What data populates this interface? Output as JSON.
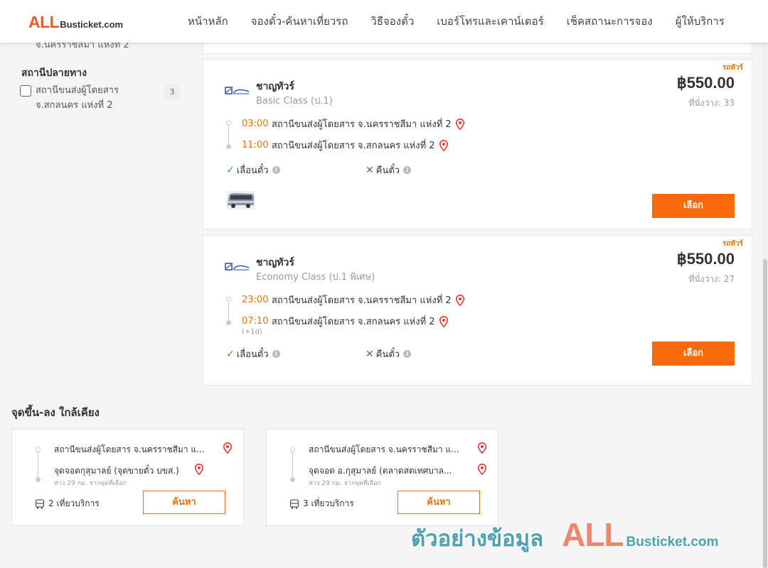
{
  "header": {
    "logo_all": "ALL",
    "logo_rest": "Busticket.com",
    "nav": [
      "หน้าหลัก",
      "จองตั๋ว-ค้นหาเที่ยวรถ",
      "วิธีจองตั๋ว",
      "เบอร์โทรและเคาน์เตอร์",
      "เช็คสถานะการจอง",
      "ผู้ให้บริการ"
    ]
  },
  "sidebar": {
    "cut_text": "จ.นครราชสีมา แห่งที่ 2",
    "filter_title": "สถานีปลายทาง",
    "filter_label": "สถานีขนส่งผู้โดยสาร จ.สกลนคร แห่งที่ 2",
    "filter_count": "3"
  },
  "results": [
    {
      "badge": "รถทัวร์",
      "operator": "ชาญทัวร์",
      "class": "Basic Class (ป.1)",
      "price": "฿550.00",
      "seats": "ที่นั่งว่าง: 33",
      "depart_time": "03:00",
      "depart_station": "สถานีขนส่งผู้โดยสาร จ.นครราชสีมา แห่งที่ 2",
      "arrive_time": "11:00",
      "arrive_station": "สถานีขนส่งผู้โดยสาร จ.สกลนคร แห่งที่ 2",
      "arrive_note": "",
      "postpone": "เลื่อนตั๋ว",
      "refund": "คืนตั๋ว",
      "select_label": "เลือก"
    },
    {
      "badge": "รถทัวร์",
      "operator": "ชาญทัวร์",
      "class": "Economy Class (ป.1 พิเศษ)",
      "price": "฿550.00",
      "seats": "ที่นั่งว่าง: 27",
      "depart_time": "23:00",
      "depart_station": "สถานีขนส่งผู้โดยสาร จ.นครราชสีมา แห่งที่ 2",
      "arrive_time": "07:10",
      "arrive_station": "สถานีขนส่งผู้โดยสาร จ.สกลนคร แห่งที่ 2",
      "arrive_note": "(+1d)",
      "postpone": "เลื่อนตั๋ว",
      "refund": "คืนตั๋ว",
      "select_label": "เลือก"
    }
  ],
  "nearby": {
    "title": "จุดขึ้น-ลง ใกล้เคียง",
    "cards": [
      {
        "from": "สถานีขนส่งผู้โดยสาร จ.นครราชสีมา แ...",
        "to": "จุดจอดกุสุมาลย์ (จุดขายตั๋ว บขส.)",
        "distance": "ห่าง 29 กม. จากจุดที่เลือก",
        "trips": "2 เที่ยวบริการ",
        "button": "ค้นหา"
      },
      {
        "from": "สถานีขนส่งผู้โดยสาร จ.นครราชสีมา แ...",
        "to": "จุดจอด อ.กุสุมาลย์ (ตลาดสดเทศบาล...",
        "distance": "ห่าง 29 กม. จากจุดที่เลือก",
        "trips": "3 เที่ยวบริการ",
        "button": "ค้นหา"
      }
    ]
  },
  "watermark": {
    "thai": "ตัวอย่างข้อมูล",
    "all": "ALL",
    "rest": "Busticket.com"
  },
  "colors": {
    "accent": "#fb6a0a",
    "time": "#f07000",
    "check": "#3aa832",
    "pin": "#e53935"
  }
}
